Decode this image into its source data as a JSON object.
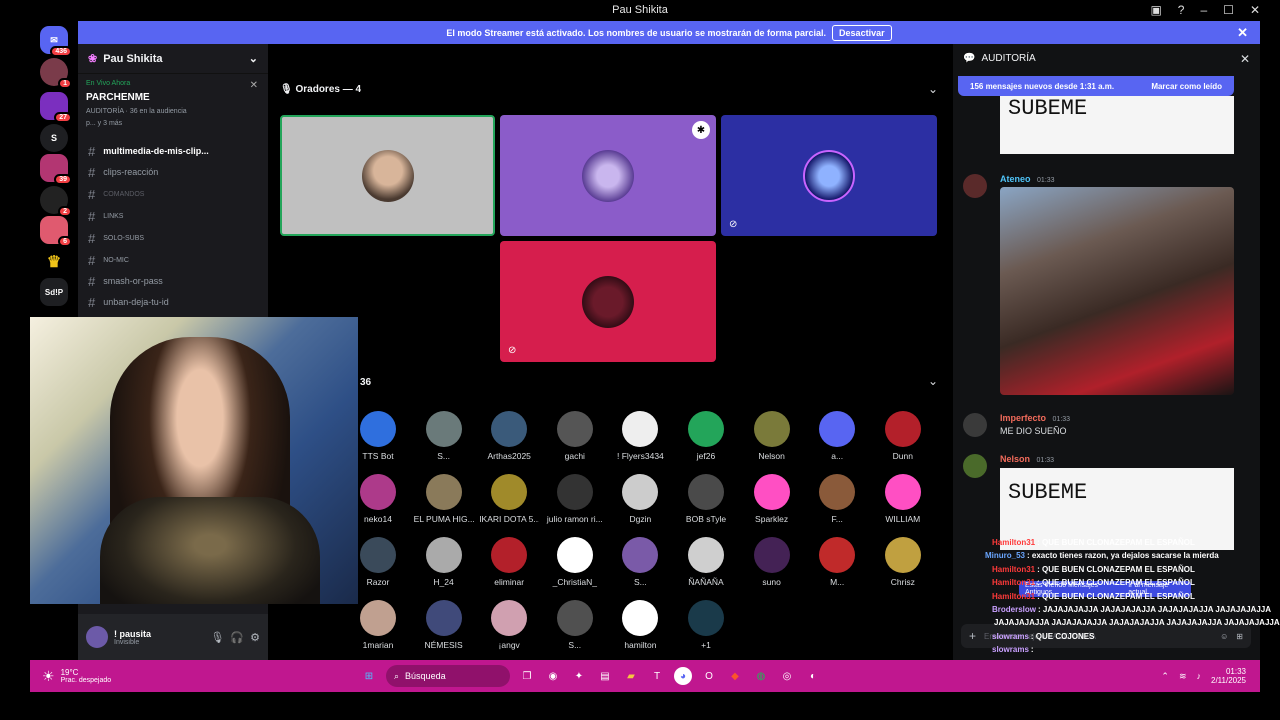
{
  "window": {
    "title": "Pau Shikita"
  },
  "streamer_bar": {
    "text": "El modo Streamer está activado. Los nombres de usuario se mostrarán de forma parcial.",
    "button": "Desactivar"
  },
  "guilds": [
    {
      "badge": "436"
    },
    {
      "badge": "1"
    },
    {
      "badge": "27"
    },
    {
      "label": "S"
    },
    {
      "badge": "39"
    },
    {
      "badge": "2"
    },
    {
      "badge": "6"
    },
    {
      "label": "♛"
    },
    {
      "label": "Sd!P"
    }
  ],
  "sidebar": {
    "server_name": "Pau Shikita",
    "live_label": "En Vivo Ahora",
    "stage_name": "PARCHENME",
    "stage_meta": "AUDITORÍA · 36 en la audiencia",
    "stage_meta2": "p... y 3 más",
    "channels": [
      {
        "name": "multimedia-de-mis-clip..."
      },
      {
        "name": "clips-reacción"
      },
      {
        "name": "comandos"
      },
      {
        "name": "links"
      },
      {
        "name": "solo-subs"
      },
      {
        "name": "no-mic"
      },
      {
        "name": "smash-or-pass"
      },
      {
        "name": "unban-deja-tu-id"
      }
    ],
    "user": {
      "name": "! pausita",
      "status": "Invisible"
    }
  },
  "stage": {
    "speakers_header": "Oradores — 4",
    "audience_count": "36",
    "audience": [
      {
        "name": "TTS Bot"
      },
      {
        "name": "S..."
      },
      {
        "name": "Arthas2025"
      },
      {
        "name": "gachi"
      },
      {
        "name": "! Flyers3434"
      },
      {
        "name": "jef26"
      },
      {
        "name": "Nelson"
      },
      {
        "name": "a..."
      },
      {
        "name": "Dunn"
      },
      {
        "name": "neko14"
      },
      {
        "name": "EL PUMA HIG..."
      },
      {
        "name": "IKARI DOTA 5..."
      },
      {
        "name": "julio ramon ri..."
      },
      {
        "name": "Dgzin"
      },
      {
        "name": "BOB sTyle"
      },
      {
        "name": "Sparklez"
      },
      {
        "name": "F..."
      },
      {
        "name": "WILLIAM"
      },
      {
        "name": "Razor"
      },
      {
        "name": "H_24"
      },
      {
        "name": "eliminar"
      },
      {
        "name": "_ChristiaN_"
      },
      {
        "name": "S..."
      },
      {
        "name": "ÑAÑAÑA"
      },
      {
        "name": "suno"
      },
      {
        "name": "M..."
      },
      {
        "name": "Chrisz"
      },
      {
        "name": "1marian"
      },
      {
        "name": "NÉMESIS"
      },
      {
        "name": "¡angv"
      },
      {
        "name": "S..."
      },
      {
        "name": "hamilton"
      },
      {
        "name": "+1"
      }
    ]
  },
  "chat": {
    "title": "AUDITORÍA",
    "new_messages": "156 mensajes nuevos desde 1:31 a.m.",
    "mark_read": "Marcar como leído",
    "image_text": "SUBEME",
    "messages": [
      {
        "author": "Ateneo",
        "time": "01:33"
      },
      {
        "author": "Imperfecto",
        "time": "01:33",
        "text": "ME DIO SUEÑO"
      },
      {
        "author": "Nelson",
        "time": "01:33"
      }
    ],
    "jump_label": "Estás Viendo Mensajes Antiguos",
    "jump_action": "Ir al mensaje actual",
    "input_placeholder": "Enviar mensaje a #AUDITORÍA"
  },
  "overlay_chat": [
    {
      "user": "Hamilton31",
      "text": ": QUE BUEN CLONAZEPAM EL ESPAÑOL"
    },
    {
      "user": "Minuro_53",
      "text": ": exacto tienes razon, ya dejalos sacarse la mierda"
    },
    {
      "user": "Hamilton31",
      "text": ": QUE BUEN CLONAZEPAM EL ESPAÑOL"
    },
    {
      "user": "Hamilton31",
      "text": ": QUE BUEN CLONAZEPAM EL ESPAÑOL"
    },
    {
      "user": "Hamilton31",
      "text": ": QUE BUEN CLONAZEPAM EL ESPAÑOL"
    },
    {
      "user": "Broderslow",
      "text": ": JAJAJAJAJJA  JAJAJAJAJJA  JAJAJAJAJJA  JAJAJAJAJJA"
    },
    {
      "user": "",
      "text": "JAJAJAJAJJA  JAJAJAJAJJA  JAJAJAJAJJA  JAJAJAJAJJA  JAJAJAJAJJA"
    },
    {
      "user": "slowrams",
      "text": ": QUE COJONES"
    },
    {
      "user": "slowrams",
      "text": ":"
    },
    {
      "user": "slowrams",
      "text": ":"
    },
    {
      "user": "slowrams",
      "text": ":"
    },
    {
      "user": "slowrams",
      "text": ":"
    }
  ],
  "taskbar": {
    "weather_temp": "19°C",
    "weather_desc": "Prac. despejado",
    "search": "Búsqueda",
    "time": "01:33",
    "date": "2/11/2025"
  }
}
